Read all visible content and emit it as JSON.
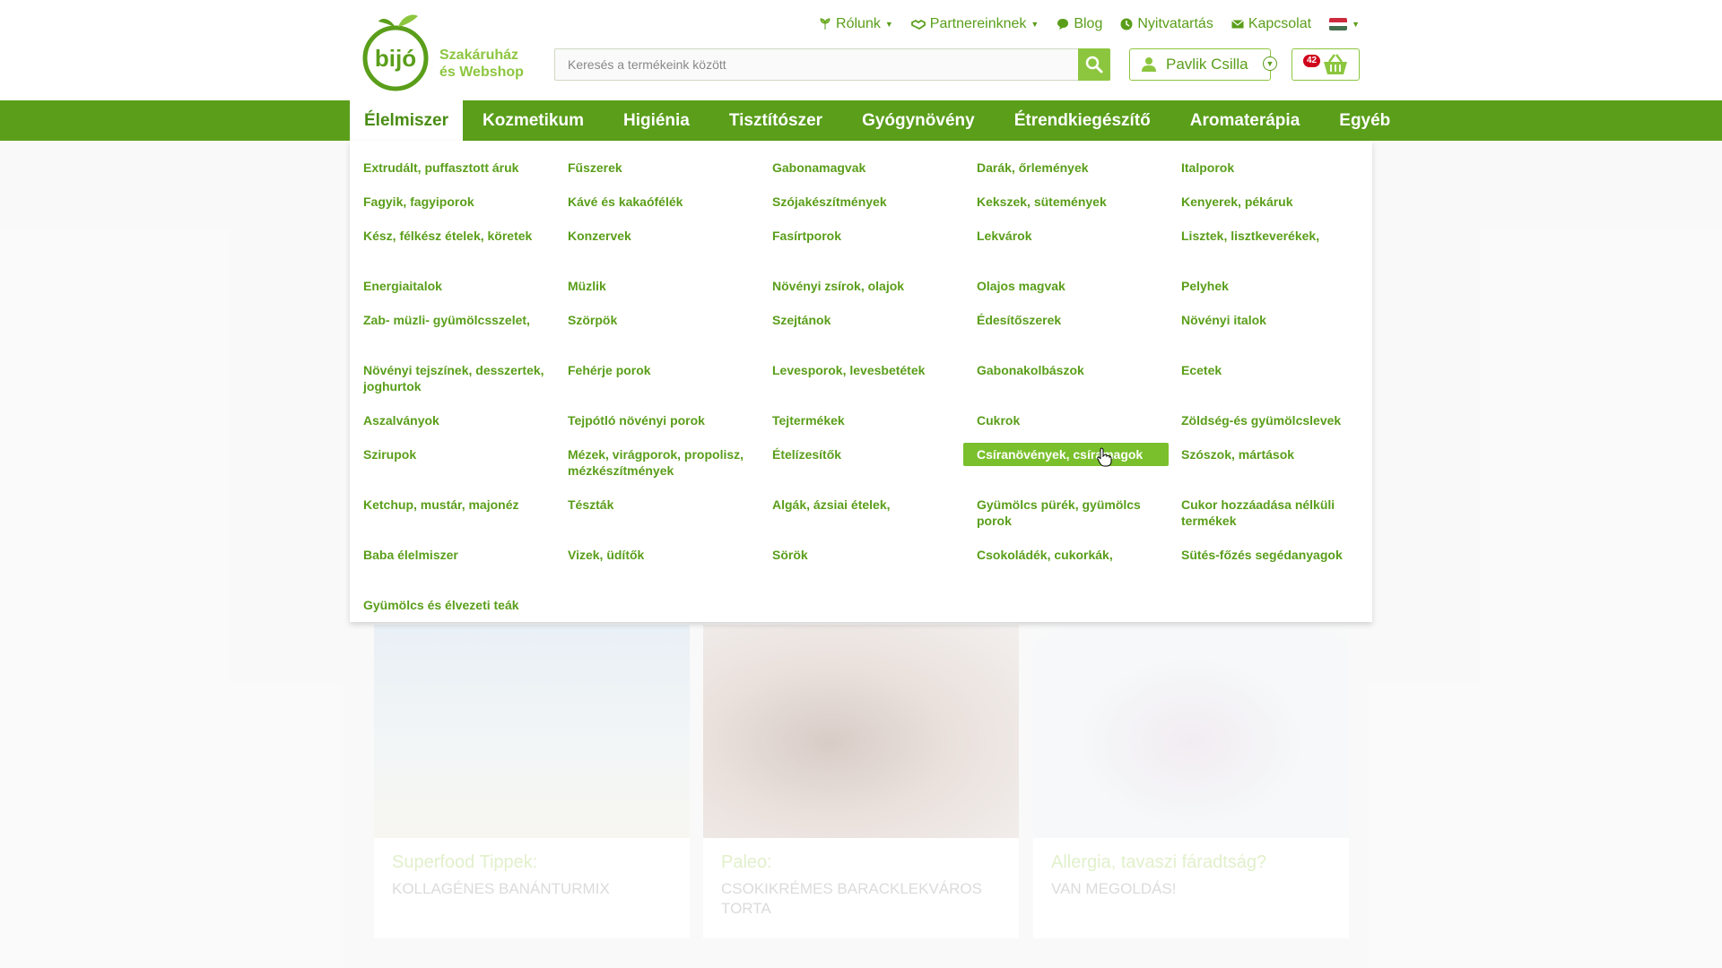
{
  "header": {
    "tagline_line1": "Szakáruház",
    "tagline_line2": "és Webshop",
    "logo_text": "bijó",
    "top_links": [
      {
        "label": "Rólunk",
        "icon": "leaf-icon",
        "dropdown": true
      },
      {
        "label": "Partnereinknek",
        "icon": "handshake-icon",
        "dropdown": true
      },
      {
        "label": "Blog",
        "icon": "chat-bubble-icon",
        "dropdown": false
      },
      {
        "label": "Nyitvatartás",
        "icon": "clock-icon",
        "dropdown": false
      },
      {
        "label": "Kapcsolat",
        "icon": "envelope-icon",
        "dropdown": false
      }
    ],
    "search_placeholder": "Keresés a termékeink között",
    "user_name": "Pavlik Csilla",
    "cart_count": "42"
  },
  "nav": {
    "items": [
      "Élelmiszer",
      "Kozmetikum",
      "Higiénia",
      "Tisztítószer",
      "Gyógynövény",
      "Étrendkiegészítő",
      "Aromaterápia",
      "Egyéb"
    ],
    "active": "Élelmiszer"
  },
  "menu": {
    "columns": [
      [
        "Extrudált, puffasztott áruk",
        "Fagyik, fagyiporok",
        "Kész, félkész ételek, köretek",
        "Energiaitalok",
        "Zab- müzli- gyümölcsszelet,",
        "Növényi tejszínek, desszertek, joghurtok",
        "Aszalványok",
        "Szirupok",
        "Ketchup, mustár, majonéz",
        "Baba élelmiszer",
        "Gyümölcs és élvezeti teák"
      ],
      [
        "Fűszerek",
        "Kávé és kakaófélék",
        "Konzervek",
        "Müzlik",
        "Szörpök",
        "Fehérje porok",
        "Tejpótló növényi porok",
        "Mézek, virágporok, propolisz, mézkészítmények",
        "Tészták",
        "Vizek, üdítők"
      ],
      [
        "Gabonamagvak",
        "Szójakészítmények",
        "Fasírtporok",
        "Növényi zsírok, olajok",
        "Szejtánok",
        "Levesporok, levesbetétek",
        "Tejtermékek",
        "Ételízesítők",
        "Algák, ázsiai ételek,",
        "Sörök"
      ],
      [
        "Darák, őrlemények",
        "Kekszek, sütemények",
        "Lekvárok",
        "Olajos magvak",
        "Édesítőszerek",
        "Gabonakolbászok",
        "Cukrok",
        "Csíranövények, csíramagok",
        "Gyümölcs pürék, gyümölcs porok",
        "Csokoládék, cukorkák,"
      ],
      [
        "Italporok",
        "Kenyerek, pékáruk",
        "Lisztek, lisztkeverékek,",
        "Pelyhek",
        "Növényi italok",
        "Ecetek",
        "Zöldség-és gyümölcslevek",
        "Szószok, mártások",
        "Cukor hozzáadása nélküli termékek",
        "Sütés-főzés segédanyagok"
      ]
    ],
    "hovered": "Csíranövények, csíramagok"
  },
  "cards": [
    {
      "title": "Superfood Tippek:",
      "subtitle": "KOLLAGÉNES BANÁNTURMIX"
    },
    {
      "title": "Paleo:",
      "subtitle": "CSOKIKRÉMES BARACKLEKVÁROS TORTA"
    },
    {
      "title": "Allergia, tavaszi fáradtság?",
      "subtitle": "VAN MEGOLDÁS!"
    }
  ],
  "colors": {
    "brand_green": "#5a9e1a",
    "light_green": "#8cc63f",
    "hover_green": "#7ac02d",
    "flag": [
      "#cd2a3e",
      "#ffffff",
      "#436f4d"
    ]
  }
}
